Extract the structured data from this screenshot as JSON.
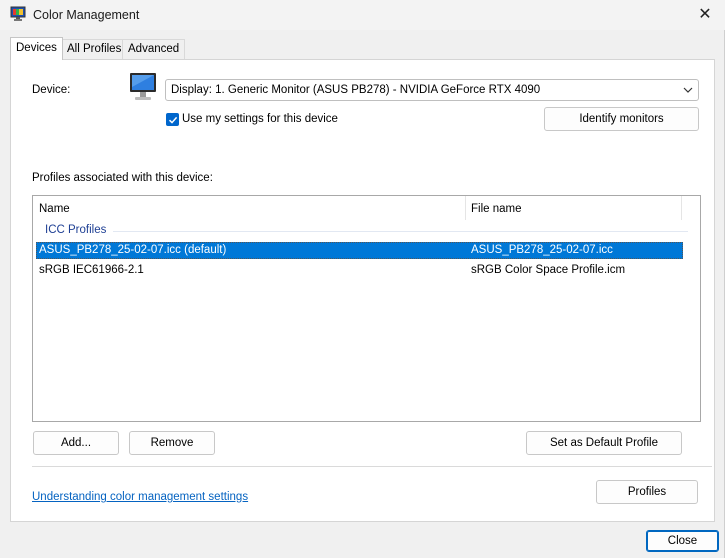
{
  "window": {
    "title": "Color Management"
  },
  "tabs": [
    {
      "label": "Devices",
      "active": true
    },
    {
      "label": "All Profiles",
      "active": false
    },
    {
      "label": "Advanced",
      "active": false
    }
  ],
  "device": {
    "label": "Device:",
    "selected": "Display: 1. Generic Monitor (ASUS PB278) - NVIDIA GeForce RTX 4090",
    "use_my_settings_label": "Use my settings for this device",
    "use_my_settings_checked": true,
    "identify_button": "Identify monitors"
  },
  "profiles": {
    "section_label": "Profiles associated with this device:",
    "columns": {
      "name": "Name",
      "file": "File name"
    },
    "group_label": "ICC Profiles",
    "rows": [
      {
        "name": "ASUS_PB278_25-02-07.icc (default)",
        "file": "ASUS_PB278_25-02-07.icc",
        "selected": true
      },
      {
        "name": "sRGB IEC61966-2.1",
        "file": "sRGB Color Space Profile.icm",
        "selected": false
      }
    ],
    "add_button": "Add...",
    "remove_button": "Remove",
    "set_default_button": "Set as Default Profile"
  },
  "footer": {
    "link_text": "Understanding color management settings",
    "profiles_button": "Profiles",
    "close_button": "Close"
  },
  "colors": {
    "accent": "#0078d7",
    "link": "#0563c1",
    "group_header": "#1e3f94"
  }
}
